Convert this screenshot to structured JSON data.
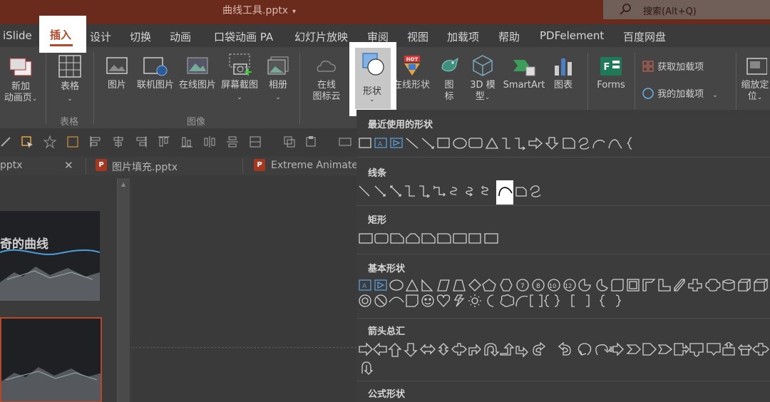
{
  "titlebar": {
    "file_title": "曲线工具.pptx",
    "title_arrow": "▾",
    "search_placeholder": "搜索(Alt+Q)"
  },
  "tabs": [
    "iSlide",
    "插入",
    "设计",
    "切换",
    "动画",
    "口袋动画 PA",
    "幻灯片放映",
    "审阅",
    "视图",
    "加载项",
    "帮助",
    "PDFelement",
    "百度网盘"
  ],
  "active_tab": "插入",
  "ribbon": {
    "new_anim_page": [
      "新加",
      "动画页"
    ],
    "table": "表格",
    "table_group": "表格",
    "picture": "图片",
    "online_picture_linked": "联机图片",
    "online_picture": "在线图片",
    "screenshot": "屏幕截图",
    "album": "相册",
    "image_group": "图像",
    "online_icon_cloud": [
      "在线",
      "图标云"
    ],
    "shapes": "形状",
    "online_shapes": "在线形状",
    "icons": [
      "图",
      "标"
    ],
    "model_3d": [
      "3D 模",
      "型"
    ],
    "smartart": "SmartArt",
    "chart": "图表",
    "forms": "Forms",
    "get_addins": "获取加载项",
    "my_addins": "我的加载项",
    "zoom_to": [
      "缩放定",
      "位"
    ],
    "chevron": "⌄",
    "hot_badge": "HOT"
  },
  "doc_tabs": [
    {
      "label": "pptx"
    },
    {
      "label": "图片填充.pptx"
    },
    {
      "label": "Extreme Animatec"
    }
  ],
  "doc_close": "✕",
  "thumb_title": "奇的曲线",
  "shapes_panel": {
    "sections": [
      "最近使用的形状",
      "线条",
      "矩形",
      "基本形状",
      "箭头总汇",
      "公式形状"
    ]
  },
  "colors": {
    "accent": "#b7472a",
    "titlebar": "#6a2a1c",
    "ribbon": "#454545",
    "panel": "#3c3c3c"
  }
}
